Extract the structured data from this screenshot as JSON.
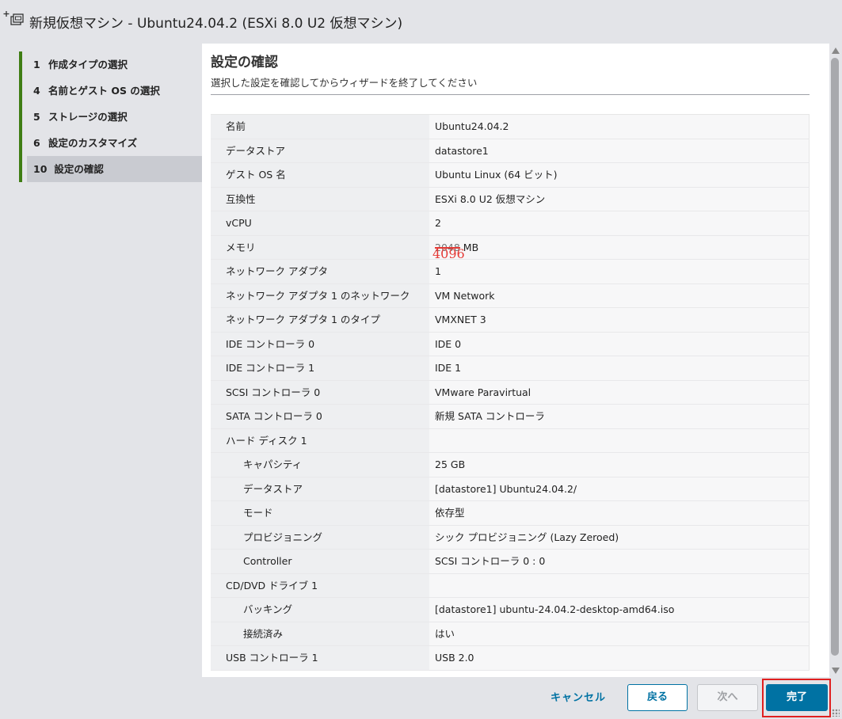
{
  "window": {
    "title": "新規仮想マシン - Ubuntu24.04.2 (ESXi 8.0 U2 仮想マシン)",
    "icon": "add-vm-icon"
  },
  "sidebar": {
    "items": [
      {
        "num": "1",
        "label": "作成タイプの選択",
        "active": false
      },
      {
        "num": "4",
        "label": "名前とゲスト OS の選択",
        "active": false
      },
      {
        "num": "5",
        "label": "ストレージの選択",
        "active": false
      },
      {
        "num": "6",
        "label": "設定のカスタマイズ",
        "active": false
      },
      {
        "num": "10",
        "label": "設定の確認",
        "active": true
      }
    ]
  },
  "main": {
    "heading": "設定の確認",
    "subheading": "選択した設定を確認してからウィザードを終了してください",
    "rows": [
      {
        "key": "名前",
        "value": "Ubuntu24.04.2",
        "indent": false
      },
      {
        "key": "データストア",
        "value": "datastore1",
        "indent": false
      },
      {
        "key": "ゲスト OS 名",
        "value": "Ubuntu Linux (64 ビット)",
        "indent": false
      },
      {
        "key": "互換性",
        "value": "ESXi 8.0 U2 仮想マシン",
        "indent": false
      },
      {
        "key": "vCPU",
        "value": "2",
        "indent": false
      },
      {
        "key": "メモリ",
        "value_struck": "2048",
        "value_suffix": " MB",
        "annotation": "4096",
        "indent": false
      },
      {
        "key": "ネットワーク アダプタ",
        "value": "1",
        "indent": false
      },
      {
        "key": "ネットワーク アダプタ 1 のネットワーク",
        "value": "VM Network",
        "indent": false
      },
      {
        "key": "ネットワーク アダプタ 1 のタイプ",
        "value": "VMXNET 3",
        "indent": false
      },
      {
        "key": "IDE コントローラ 0",
        "value": "IDE 0",
        "indent": false
      },
      {
        "key": "IDE コントローラ 1",
        "value": "IDE 1",
        "indent": false
      },
      {
        "key": "SCSI コントローラ 0",
        "value": "VMware Paravirtual",
        "indent": false
      },
      {
        "key": "SATA コントローラ 0",
        "value": "新規 SATA コントローラ",
        "indent": false
      },
      {
        "key": "ハード ディスク 1",
        "value": "",
        "indent": false
      },
      {
        "key": "キャパシティ",
        "value": "25 GB",
        "indent": true
      },
      {
        "key": "データストア",
        "value": "[datastore1] Ubuntu24.04.2/",
        "indent": true
      },
      {
        "key": "モード",
        "value": "依存型",
        "indent": true
      },
      {
        "key": "プロビジョニング",
        "value": "シック プロビジョニング (Lazy Zeroed)",
        "indent": true
      },
      {
        "key": "Controller",
        "value": "SCSI コントローラ 0 : 0",
        "indent": true
      },
      {
        "key": "CD/DVD ドライブ 1",
        "value": "",
        "indent": false
      },
      {
        "key": "バッキング",
        "value": "[datastore1] ubuntu-24.04.2-desktop-amd64.iso",
        "indent": true
      },
      {
        "key": "接続済み",
        "value": "はい",
        "indent": true
      },
      {
        "key": "USB コントローラ 1",
        "value": "USB 2.0",
        "indent": false
      }
    ]
  },
  "footer": {
    "cancel_label": "キャンセル",
    "back_label": "戻る",
    "next_label": "次へ",
    "finish_label": "完了"
  },
  "colors": {
    "accent": "#0072a3",
    "step_bar": "#3f7d14",
    "highlight": "#e02020"
  }
}
